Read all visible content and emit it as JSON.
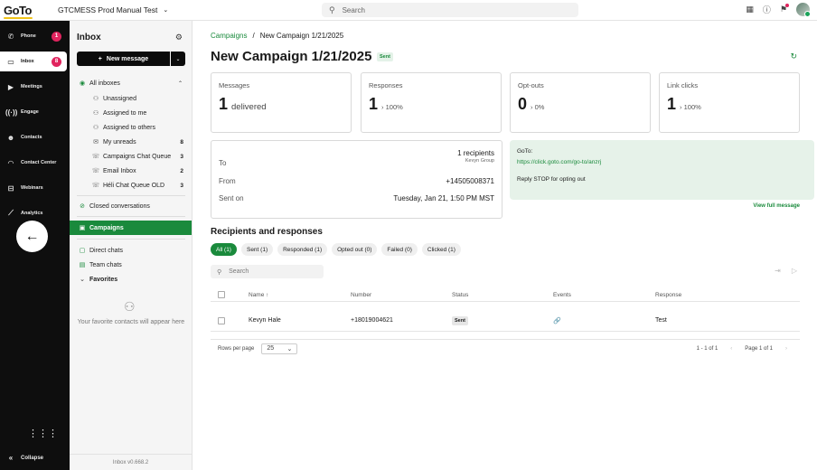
{
  "topbar": {
    "logo": "GoTo",
    "tenant": "GTCMESS Prod Manual Test",
    "search_placeholder": "Search"
  },
  "leftnav": {
    "items": [
      {
        "label": "Phone",
        "badge": "1"
      },
      {
        "label": "Inbox",
        "badge": "8"
      },
      {
        "label": "Meetings"
      },
      {
        "label": "Engage"
      },
      {
        "label": "Contacts"
      },
      {
        "label": "Contact Center"
      },
      {
        "label": "Webinars"
      },
      {
        "label": "Analytics"
      }
    ],
    "collapse": "Collapse"
  },
  "inbox": {
    "title": "Inbox",
    "new_message": "New message",
    "all_inboxes": "All inboxes",
    "rows": [
      {
        "label": "Unassigned",
        "count": ""
      },
      {
        "label": "Assigned to me",
        "count": ""
      },
      {
        "label": "Assigned to others",
        "count": ""
      },
      {
        "label": "My unreads",
        "count": "8"
      },
      {
        "label": "Campaigns Chat Queue",
        "count": "3"
      },
      {
        "label": "Email Inbox",
        "count": "2"
      },
      {
        "label": "Héli Chat Queue OLD",
        "count": "3"
      }
    ],
    "closed": "Closed conversations",
    "campaigns": "Campaigns",
    "direct": "Direct chats",
    "team": "Team chats",
    "favorites": "Favorites",
    "fav_empty": "Your favorite contacts will appear here",
    "version": "Inbox v0.668.2"
  },
  "main": {
    "crumb_parent": "Campaigns",
    "crumb_sep": "/",
    "crumb_current": "New Campaign 1/21/2025",
    "title": "New Campaign 1/21/2025",
    "status": "Sent",
    "stats": [
      {
        "label": "Messages",
        "num": "1",
        "unit": "delivered",
        "pct": ""
      },
      {
        "label": "Responses",
        "num": "1",
        "unit": "",
        "pct": "› 100%"
      },
      {
        "label": "Opt-outs",
        "num": "0",
        "unit": "",
        "pct": "› 0%"
      },
      {
        "label": "Link clicks",
        "num": "1",
        "unit": "",
        "pct": "› 100%"
      }
    ],
    "details": {
      "to_label": "To",
      "to_value": "1 recipients",
      "to_sub": "Kevyn Group",
      "from_label": "From",
      "from_value": "+14505008371",
      "sent_label": "Sent on",
      "sent_value": "Tuesday, Jan 21, 1:50 PM MST"
    },
    "preview": {
      "line1": "GoTo:",
      "link": "https://click.goto.com/go-to/anzrj",
      "stop": "Reply STOP for opting out",
      "view_full": "View full message"
    },
    "section_title": "Recipients and responses",
    "filters": [
      "All (1)",
      "Sent (1)",
      "Responded (1)",
      "Opted out (0)",
      "Failed (0)",
      "Clicked (1)"
    ],
    "search_placeholder": "Search",
    "table": {
      "headers": {
        "name": "Name",
        "number": "Number",
        "status": "Status",
        "events": "Events",
        "response": "Response"
      },
      "rows": [
        {
          "name": "Kevyn Hale",
          "number": "+18019004621",
          "status": "Sent",
          "response": "Test"
        }
      ]
    },
    "pager": {
      "rows_label": "Rows per page",
      "rows_value": "25",
      "range": "1 - 1 of 1",
      "page": "Page 1 of 1"
    }
  }
}
